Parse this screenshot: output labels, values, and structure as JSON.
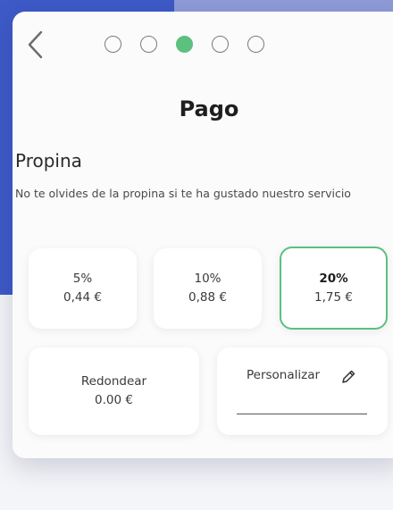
{
  "header": {
    "title": "Pago",
    "step_count": 5,
    "active_step": 3
  },
  "tip": {
    "section_title": "Propina",
    "description": "No te olvides de la propina si te ha gustado nuestro servicio",
    "options": [
      {
        "percent": "5%",
        "amount": "0,44 €",
        "selected": false
      },
      {
        "percent": "10%",
        "amount": "0,88 €",
        "selected": false
      },
      {
        "percent": "20%",
        "amount": "1,75 €",
        "selected": true
      }
    ],
    "round": {
      "label": "Redondear",
      "amount": "0.00 €"
    },
    "custom": {
      "label": "Personalizar",
      "value": "",
      "icon": "pencil-icon"
    }
  },
  "colors": {
    "accent": "#5cc07f",
    "background_blue": "#3d5ac7",
    "background_lilac": "#8e9bd8"
  }
}
